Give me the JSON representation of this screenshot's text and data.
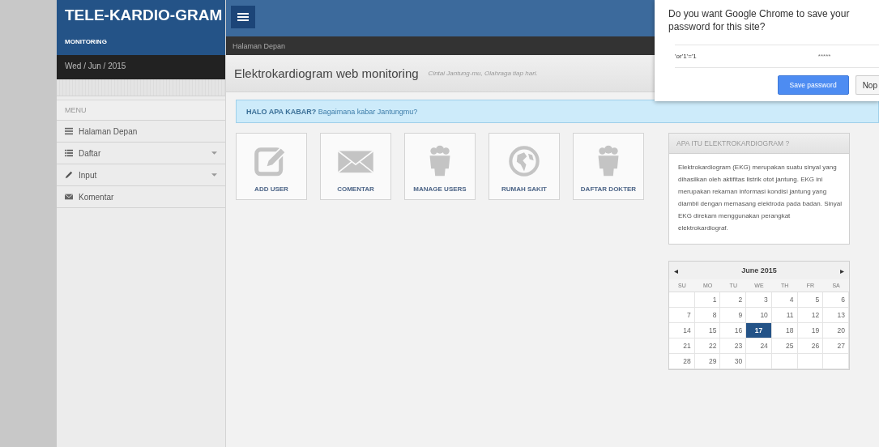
{
  "sidebar": {
    "brand": "TELE-KARDIO-GRAM",
    "subtitle": "MONITORING",
    "date": "Wed / Jun / 2015",
    "menu_heading": "MENU",
    "items": [
      {
        "label": "Halaman Depan",
        "kind": "lines",
        "has_submenu": false
      },
      {
        "label": "Daftar",
        "kind": "list",
        "has_submenu": true
      },
      {
        "label": "Input",
        "kind": "pencil",
        "has_submenu": true
      },
      {
        "label": "Komentar",
        "kind": "mail",
        "has_submenu": false
      }
    ]
  },
  "breadcrumb": "Halaman Depan",
  "page_title": "Elektrokardiogram web monitoring",
  "page_subtitle": "Cintai Jantung-mu, Olahraga tiap hari.",
  "alert": {
    "strong": "HALO APA KABAR?",
    "text": "Bagaimana kabar Jantungmu?"
  },
  "tiles": [
    {
      "label": "ADD USER",
      "kind": "edit"
    },
    {
      "label": "COMENTAR",
      "kind": "mail"
    },
    {
      "label": "MANAGE USERS",
      "kind": "users"
    },
    {
      "label": "RUMAH SAKIT",
      "kind": "globe"
    },
    {
      "label": "DAFTAR DOKTER",
      "kind": "users"
    }
  ],
  "info": {
    "title": "APA ITU ELEKTROKARDIOGRAM ?",
    "text": "Elektrokardiogram (EKG) merupakan suatu sinyal yang dihasilkan oleh aktifitas listrik otot jantung. EKG ini merupakan rekaman informasi kondisi jantung yang diambil dengan memasang elektroda pada badan. Sinyal EKG direkam menggunakan perangkat elektrokardiograf."
  },
  "calendar": {
    "prev": "◂",
    "month": "June 2015",
    "next": "▸",
    "weekdays": [
      "SU",
      "MO",
      "TU",
      "WE",
      "TH",
      "FR",
      "SA"
    ],
    "weeks": [
      [
        {
          "kind": "empty"
        },
        {
          "kind": "day",
          "day": "1",
          "selected": false
        },
        {
          "kind": "day",
          "day": "2",
          "selected": false
        },
        {
          "kind": "day",
          "day": "3",
          "selected": false
        },
        {
          "kind": "day",
          "day": "4",
          "selected": false
        },
        {
          "kind": "day",
          "day": "5",
          "selected": false
        },
        {
          "kind": "day",
          "day": "6",
          "selected": false
        }
      ],
      [
        {
          "kind": "day",
          "day": "7",
          "selected": false
        },
        {
          "kind": "day",
          "day": "8",
          "selected": false
        },
        {
          "kind": "day",
          "day": "9",
          "selected": false
        },
        {
          "kind": "day",
          "day": "10",
          "selected": false
        },
        {
          "kind": "day",
          "day": "11",
          "selected": false
        },
        {
          "kind": "day",
          "day": "12",
          "selected": false
        },
        {
          "kind": "day",
          "day": "13",
          "selected": false
        }
      ],
      [
        {
          "kind": "day",
          "day": "14",
          "selected": false
        },
        {
          "kind": "day",
          "day": "15",
          "selected": false
        },
        {
          "kind": "day",
          "day": "16",
          "selected": false
        },
        {
          "kind": "day",
          "day": "17",
          "selected": true
        },
        {
          "kind": "day",
          "day": "18",
          "selected": false
        },
        {
          "kind": "day",
          "day": "19",
          "selected": false
        },
        {
          "kind": "day",
          "day": "20",
          "selected": false
        }
      ],
      [
        {
          "kind": "day",
          "day": "21",
          "selected": false
        },
        {
          "kind": "day",
          "day": "22",
          "selected": false
        },
        {
          "kind": "day",
          "day": "23",
          "selected": false
        },
        {
          "kind": "day",
          "day": "24",
          "selected": false
        },
        {
          "kind": "day",
          "day": "25",
          "selected": false
        },
        {
          "kind": "day",
          "day": "26",
          "selected": false
        },
        {
          "kind": "day",
          "day": "27",
          "selected": false
        }
      ],
      [
        {
          "kind": "day",
          "day": "28",
          "selected": false
        },
        {
          "kind": "day",
          "day": "29",
          "selected": false
        },
        {
          "kind": "day",
          "day": "30",
          "selected": false
        },
        {
          "kind": "empty"
        },
        {
          "kind": "empty"
        },
        {
          "kind": "empty"
        },
        {
          "kind": "empty"
        }
      ]
    ]
  },
  "password_prompt": {
    "question": "Do you want Google Chrome to save your password for this site?",
    "username": "'or'1'='1",
    "password": "*****",
    "buttons": [
      "Save password",
      "Nop"
    ]
  }
}
